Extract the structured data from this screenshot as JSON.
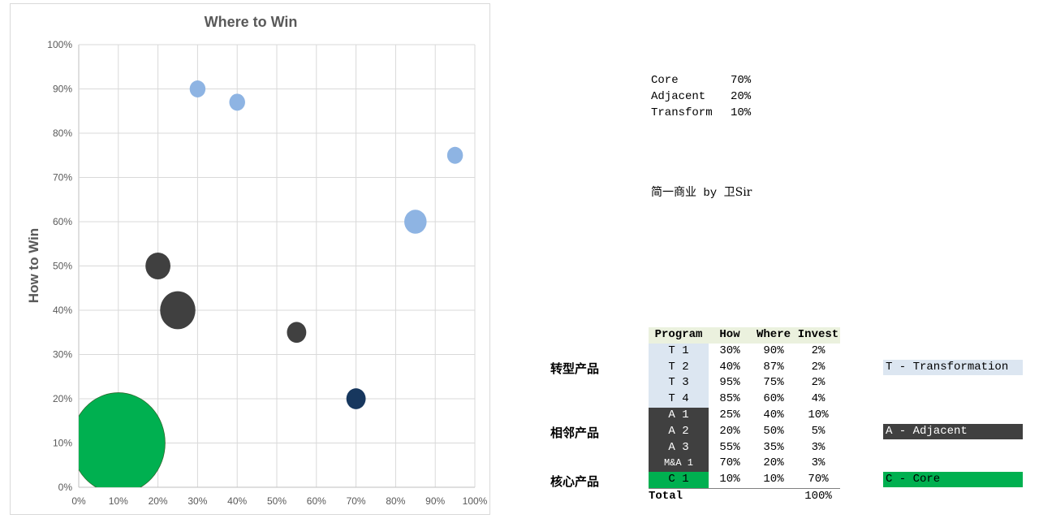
{
  "chart_data": {
    "type": "bubble",
    "title": "Where to Win",
    "xlabel": "",
    "ylabel": "How to Win",
    "xlim": [
      0,
      100
    ],
    "ylim": [
      0,
      100
    ],
    "x_ticks": [
      "0%",
      "10%",
      "20%",
      "30%",
      "40%",
      "50%",
      "60%",
      "70%",
      "80%",
      "90%",
      "100%"
    ],
    "y_ticks": [
      "0%",
      "10%",
      "20%",
      "30%",
      "40%",
      "50%",
      "60%",
      "70%",
      "80%",
      "90%",
      "100%"
    ],
    "grid": true,
    "legend": "none",
    "points": [
      {
        "name": "T 1",
        "x": 30,
        "y": 90,
        "size": 2,
        "color": "#8eb4e3"
      },
      {
        "name": "T 2",
        "x": 40,
        "y": 87,
        "size": 2,
        "color": "#8eb4e3"
      },
      {
        "name": "T 3",
        "x": 95,
        "y": 75,
        "size": 2,
        "color": "#8eb4e3"
      },
      {
        "name": "T 4",
        "x": 85,
        "y": 60,
        "size": 4,
        "color": "#8eb4e3"
      },
      {
        "name": "A 1",
        "x": 25,
        "y": 40,
        "size": 10,
        "color": "#404040"
      },
      {
        "name": "A 2",
        "x": 20,
        "y": 50,
        "size": 5,
        "color": "#404040"
      },
      {
        "name": "A 3",
        "x": 55,
        "y": 35,
        "size": 3,
        "color": "#404040"
      },
      {
        "name": "M&A 1",
        "x": 70,
        "y": 20,
        "size": 3,
        "color": "#17375e"
      },
      {
        "name": "C 1",
        "x": 10,
        "y": 10,
        "size": 70,
        "color": "#00b050"
      }
    ]
  },
  "summary": [
    {
      "label": "Core",
      "value": "70%"
    },
    {
      "label": "Adjacent",
      "value": "20%"
    },
    {
      "label": "Transform",
      "value": "10%"
    }
  ],
  "credit": {
    "cn": "简一商业",
    "en": " by ",
    "name": "卫Sir"
  },
  "table": {
    "headers": [
      "Program",
      "How",
      "Where",
      "Invest"
    ],
    "rows": [
      {
        "program": "T 1",
        "how": "30%",
        "where": "90%",
        "invest": "2%",
        "group": "t"
      },
      {
        "program": "T 2",
        "how": "40%",
        "where": "87%",
        "invest": "2%",
        "group": "t"
      },
      {
        "program": "T 3",
        "how": "95%",
        "where": "75%",
        "invest": "2%",
        "group": "t"
      },
      {
        "program": "T 4",
        "how": "85%",
        "where": "60%",
        "invest": "4%",
        "group": "t"
      },
      {
        "program": "A 1",
        "how": "25%",
        "where": "40%",
        "invest": "10%",
        "group": "a"
      },
      {
        "program": "A 2",
        "how": "20%",
        "where": "50%",
        "invest": "5%",
        "group": "a"
      },
      {
        "program": "A 3",
        "how": "55%",
        "where": "35%",
        "invest": "3%",
        "group": "a"
      },
      {
        "program": "M&A 1",
        "how": "70%",
        "where": "20%",
        "invest": "3%",
        "group": "a"
      },
      {
        "program": "C 1",
        "how": "10%",
        "where": "10%",
        "invest": "70%",
        "group": "c"
      }
    ],
    "total_label": "Total",
    "total_value": "100%"
  },
  "groups": {
    "transform": "转型产品",
    "adjacent": "相邻产品",
    "core": "核心产品"
  },
  "legend_boxes": {
    "t": {
      "label": "T - Transformation",
      "bg": "#dce6f1",
      "fg": "#000000"
    },
    "a": {
      "label": "A - Adjacent",
      "bg": "#404040",
      "fg": "#ffffff"
    },
    "c": {
      "label": "C - Core",
      "bg": "#00b050",
      "fg": "#000000"
    }
  }
}
